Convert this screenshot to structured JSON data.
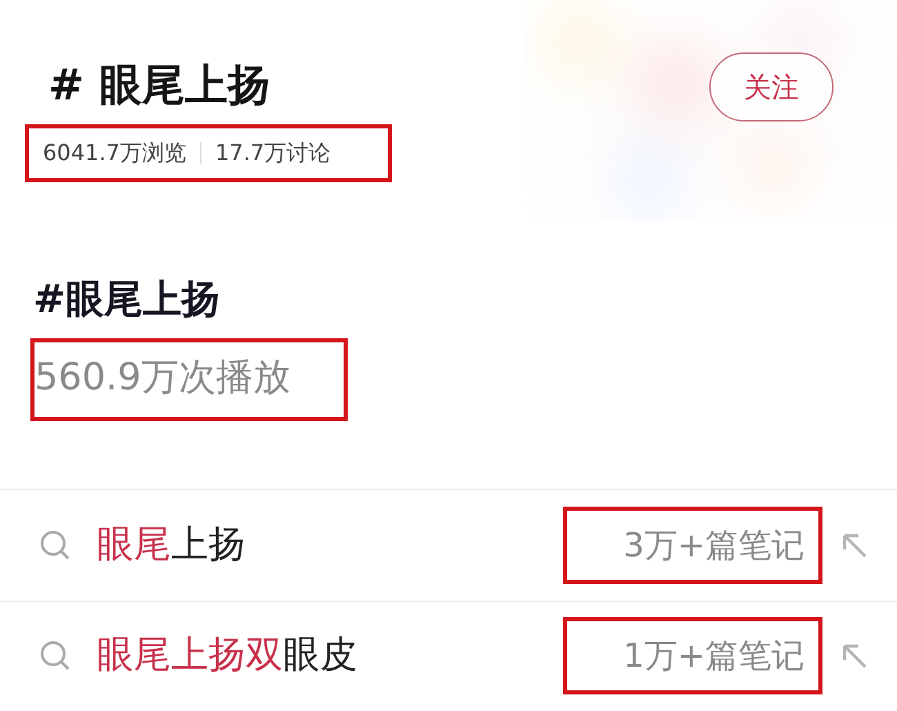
{
  "topic_header": {
    "title": "# 眼尾上扬",
    "stats": {
      "highlighted": true,
      "views": "6041.7万浏览",
      "discussions": "17.7万讨论"
    },
    "follow_button": "关注"
  },
  "video_topic": {
    "title": "#眼尾上扬",
    "plays": {
      "highlighted": true,
      "text": "560.9万次播放"
    }
  },
  "suggestions": [
    {
      "match": "眼尾",
      "rest": "上扬",
      "count": "3万+篇笔记",
      "highlighted": true
    },
    {
      "match": "眼尾上扬双",
      "rest": "眼皮",
      "count": "1万+篇笔记",
      "highlighted": true
    }
  ]
}
